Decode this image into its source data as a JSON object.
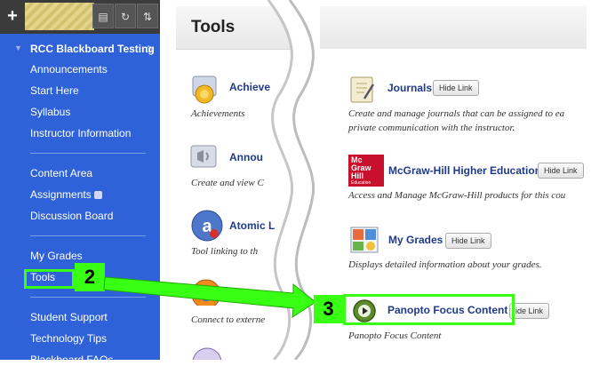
{
  "toolbar": {
    "plus": "+",
    "btn_folder": "▤",
    "btn_refresh": "↻",
    "btn_sort": "⇅"
  },
  "menu": {
    "course_title": "RCC Blackboard Testing",
    "items": [
      "Announcements",
      "Start Here",
      "Syllabus",
      "Instructor Information",
      "Content Area",
      "Assignments",
      "Discussion Board",
      "My Grades",
      "Tools",
      "Student Support",
      "Technology Tips",
      "Blackboard FAQs"
    ]
  },
  "page": {
    "title": "Tools"
  },
  "tools_left": [
    {
      "link": "Achieve",
      "desc": "Achievements"
    },
    {
      "link": "Annou",
      "desc": "Create and view C"
    },
    {
      "link": "Atomic L",
      "desc": "Tool linking to th"
    },
    {
      "link": "",
      "desc": "Connect to externe"
    }
  ],
  "tools_right": [
    {
      "link": "Journals",
      "hide": "Hide Link",
      "desc1": "Create and manage journals that can be assigned to ea",
      "desc2": "private communication with the instructor."
    },
    {
      "link": "McGraw-Hill Higher Education",
      "hide": "Hide Link",
      "desc1": "Access and Manage McGraw-Hill products for this cou",
      "desc2": ""
    },
    {
      "link": "My Grades",
      "hide": "Hide Link",
      "desc1": "Displays detailed information about your grades.",
      "desc2": ""
    },
    {
      "link": "Panopto Focus Content",
      "hide": "ide Link",
      "desc1": "Panopto Focus Content",
      "desc2": ""
    }
  ],
  "mcgraw_logo": {
    "line1": "Mc",
    "line2": "Graw",
    "line3": "Hill",
    "line4": "Education"
  },
  "callouts": {
    "step2": "2",
    "step3": "3"
  },
  "colors": {
    "menu_bg": "#2f62d8",
    "highlight": "#39ff14",
    "link": "#1f3a8a"
  }
}
